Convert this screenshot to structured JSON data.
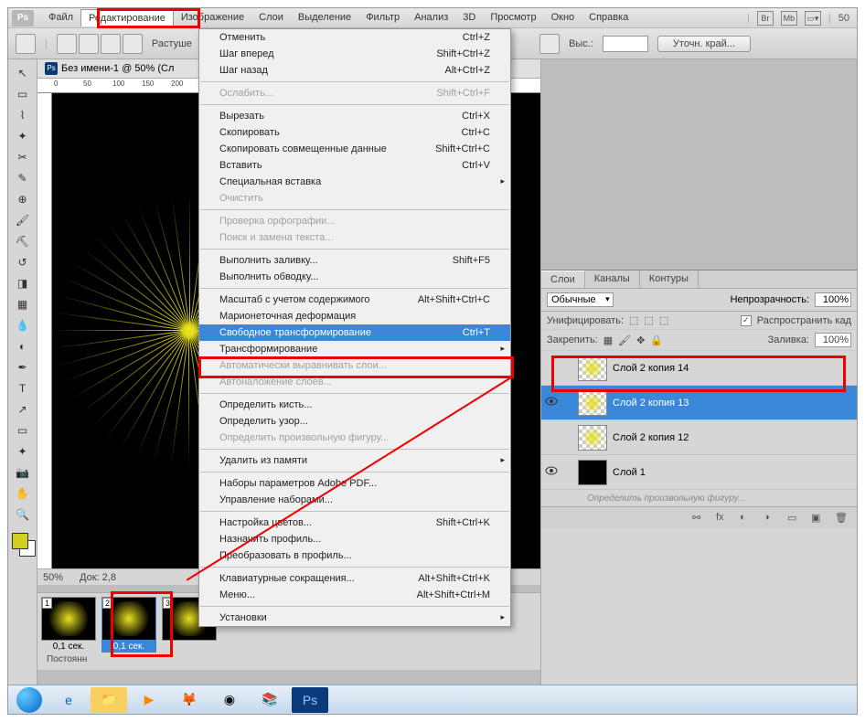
{
  "menubar": {
    "items": [
      "Файл",
      "Редактирование",
      "Изображение",
      "Слои",
      "Выделение",
      "Фильтр",
      "Анализ",
      "3D",
      "Просмотр",
      "Окно",
      "Справка"
    ],
    "zoom_readout": "50"
  },
  "optbar": {
    "feather_label": "Растуше",
    "height_label": "Выс.:",
    "refine_btn": "Уточн. край..."
  },
  "doc": {
    "tab_title": "Без имени-1 @ 50% (Сл",
    "zoom": "50%",
    "docsize": "Док: 2,8",
    "ruler_marks": [
      "0",
      "50",
      "100",
      "150",
      "200"
    ]
  },
  "anim": {
    "frames": [
      {
        "num": "1",
        "time": "0,1 сек."
      },
      {
        "num": "2",
        "time": "0,1 сек."
      },
      {
        "num": "3",
        "time": ""
      }
    ],
    "status": "Постоянн"
  },
  "layers_panel": {
    "tabs": [
      "Слои",
      "Каналы",
      "Контуры"
    ],
    "blend_mode": "Обычные",
    "opacity_label": "Непрозрачность:",
    "opacity_val": "100%",
    "unify_label": "Унифицировать:",
    "propagate_label": "Распространить кад",
    "lock_label": "Закрепить:",
    "fill_label": "Заливка:",
    "fill_val": "100%",
    "layers": [
      {
        "name": "Слой 2 копия 14",
        "vis": false,
        "sel": false,
        "thumb": "rays"
      },
      {
        "name": "Слой 2 копия 13",
        "vis": true,
        "sel": true,
        "thumb": "rays"
      },
      {
        "name": "Слой 2 копия 12",
        "vis": false,
        "sel": false,
        "thumb": "rays"
      },
      {
        "name": "Слой 1",
        "vis": true,
        "sel": false,
        "thumb": "black"
      }
    ],
    "shape_hint": "Определить произвольную фигуру..."
  },
  "dropdown": {
    "groups": [
      [
        {
          "label": "Отменить",
          "short": "Ctrl+Z"
        },
        {
          "label": "Шаг вперед",
          "short": "Shift+Ctrl+Z"
        },
        {
          "label": "Шаг назад",
          "short": "Alt+Ctrl+Z"
        }
      ],
      [
        {
          "label": "Ослабить...",
          "short": "Shift+Ctrl+F",
          "disabled": true
        }
      ],
      [
        {
          "label": "Вырезать",
          "short": "Ctrl+X"
        },
        {
          "label": "Скопировать",
          "short": "Ctrl+C"
        },
        {
          "label": "Скопировать совмещенные данные",
          "short": "Shift+Ctrl+C"
        },
        {
          "label": "Вставить",
          "short": "Ctrl+V"
        },
        {
          "label": "Специальная вставка",
          "short": "",
          "sub": true
        },
        {
          "label": "Очистить",
          "short": "",
          "disabled": true
        }
      ],
      [
        {
          "label": "Проверка орфографии...",
          "short": "",
          "disabled": true
        },
        {
          "label": "Поиск и замена текста...",
          "short": "",
          "disabled": true
        }
      ],
      [
        {
          "label": "Выполнить заливку...",
          "short": "Shift+F5"
        },
        {
          "label": "Выполнить обводку...",
          "short": ""
        }
      ],
      [
        {
          "label": "Масштаб с учетом содержимого",
          "short": "Alt+Shift+Ctrl+C"
        },
        {
          "label": "Марионеточная деформация",
          "short": ""
        },
        {
          "label": "Свободное трансформирование",
          "short": "Ctrl+T",
          "hl": true
        },
        {
          "label": "Трансформирование",
          "short": "",
          "sub": true
        },
        {
          "label": "Автоматически выравнивать слои...",
          "short": "",
          "disabled": true
        },
        {
          "label": "Автоналожение слоев...",
          "short": "",
          "disabled": true
        }
      ],
      [
        {
          "label": "Определить кисть...",
          "short": ""
        },
        {
          "label": "Определить узор...",
          "short": ""
        },
        {
          "label": "Определить произвольную фигуру...",
          "short": "",
          "disabled": true
        }
      ],
      [
        {
          "label": "Удалить из памяти",
          "short": "",
          "sub": true
        }
      ],
      [
        {
          "label": "Наборы параметров Adobe PDF...",
          "short": ""
        },
        {
          "label": "Управление наборами...",
          "short": ""
        }
      ],
      [
        {
          "label": "Настройка цветов...",
          "short": "Shift+Ctrl+K"
        },
        {
          "label": "Назначить профиль...",
          "short": ""
        },
        {
          "label": "Преобразовать в профиль...",
          "short": ""
        }
      ],
      [
        {
          "label": "Клавиатурные сокращения...",
          "short": "Alt+Shift+Ctrl+K"
        },
        {
          "label": "Меню...",
          "short": "Alt+Shift+Ctrl+M"
        }
      ],
      [
        {
          "label": "Установки",
          "short": "",
          "sub": true
        }
      ]
    ]
  }
}
